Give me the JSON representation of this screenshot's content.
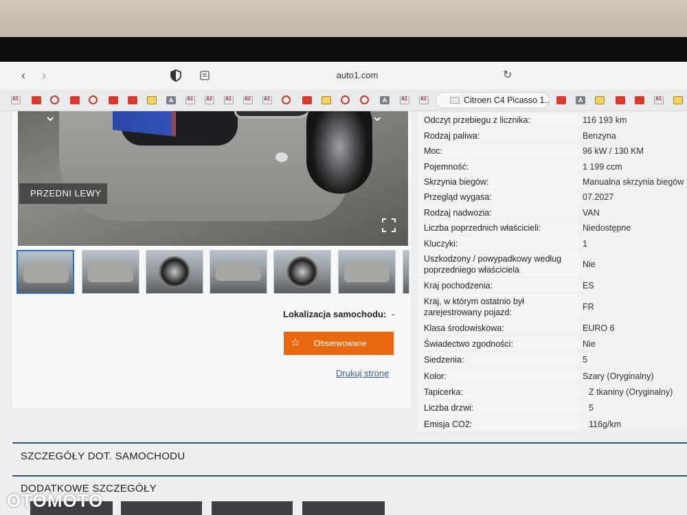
{
  "browser": {
    "url": "auto1.com",
    "active_tab_title": "Citroen C4 Picasso 1..."
  },
  "photo": {
    "label": "PRZEDNI LEWY"
  },
  "location": {
    "label": "Lokalizacja samochodu:",
    "value": "-"
  },
  "actions": {
    "watch_label": "Obserwowane",
    "print_label": "Drukuj stronę"
  },
  "specs": [
    {
      "key": "Odczyt przebiegu z licznika:",
      "value": "116 193 km"
    },
    {
      "key": "Rodzaj paliwa:",
      "value": "Benzyna"
    },
    {
      "key": "Moc:",
      "value": "96 kW / 130 KM"
    },
    {
      "key": "Pojemność:",
      "value": "1 199 ccm"
    },
    {
      "key": "Skrzynia biegów:",
      "value": "Manualna skrzynia biegów"
    },
    {
      "key": "Przegląd wygasa:",
      "value": "07.2027"
    },
    {
      "key": "Rodzaj nadwozia:",
      "value": "VAN"
    },
    {
      "key": "Liczba poprzednich właścicieli:",
      "value": "Niedostępne"
    },
    {
      "key": "Kluczyki:",
      "value": "1"
    },
    {
      "key": "Uszkodzony / powypadkowy według poprzedniego właściciela",
      "value": "Nie"
    },
    {
      "key": "Kraj pochodzenia:",
      "value": "ES"
    },
    {
      "key": "Kraj, w którym ostatnio był zarejestrowany pojazd:",
      "value": "FR"
    },
    {
      "key": "Klasa środowiskowa:",
      "value": "EURO 6"
    },
    {
      "key": "Świadectwo zgodności:",
      "value": "Nie"
    },
    {
      "key": "Siedzenia:",
      "value": "5"
    },
    {
      "key": "Kolor:",
      "value": "Szary (Oryginalny)"
    },
    {
      "key": "Tapicerka:",
      "value": "Z tkaniny (Oryginalny)"
    },
    {
      "key": "Liczba drzwi:",
      "value": "5"
    },
    {
      "key": "Emisja CO2:",
      "value": "116g/km"
    }
  ],
  "sections": {
    "car_details": "SZCZEGÓŁY DOT. SAMOCHODU",
    "additional_details": "DODATKOWE SZCZEGÓŁY"
  },
  "watermark": "OTOMOTO"
}
